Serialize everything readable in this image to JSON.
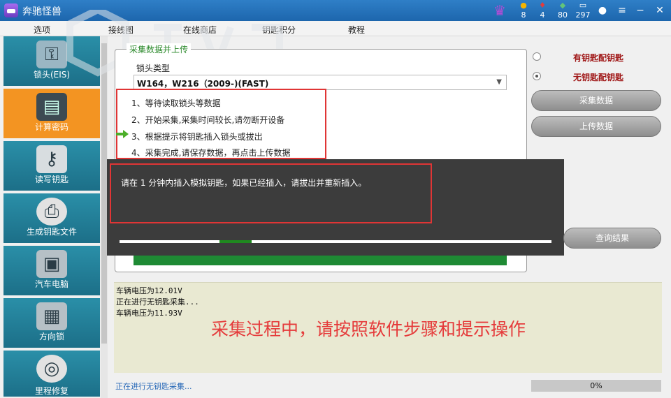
{
  "window": {
    "title": "奔驰怪兽",
    "stats": [
      {
        "icon": "coin-icon",
        "value": "8",
        "color": "#f5b400"
      },
      {
        "icon": "ruby-icon",
        "value": "4",
        "color": "#e53b3b"
      },
      {
        "icon": "diamond-icon",
        "value": "80",
        "color": "#63c47a"
      },
      {
        "icon": "battery-icon",
        "value": "297",
        "color": "#ffffff"
      }
    ]
  },
  "menu": [
    "选项",
    "接线图",
    "在线商店",
    "钥匙积分",
    "教程"
  ],
  "sidebar": {
    "items": [
      {
        "label": "锁头(EIS)",
        "icon": "lock-module-icon",
        "active": false
      },
      {
        "label": "计算密码",
        "icon": "computer-screen-icon",
        "active": true
      },
      {
        "label": "读写钥匙",
        "icon": "car-key-icon",
        "active": false
      },
      {
        "label": "生成钥匙文件",
        "icon": "printer-icon",
        "active": false
      },
      {
        "label": "汽车电脑",
        "icon": "ecu-icon",
        "active": false
      },
      {
        "label": "方向锁",
        "icon": "steering-lock-icon",
        "active": false
      },
      {
        "label": "里程修复",
        "icon": "speedometer-icon",
        "active": false
      }
    ]
  },
  "main": {
    "group_title": "采集数据并上传",
    "lock_type_label": "锁头类型",
    "lock_type_value": "W164，W216（2009-)(FAST)",
    "steps": [
      "1、等待读取锁头等数据",
      "2、开始采集,采集时间较长,请勿断开设备",
      "3、根据提示将钥匙插入锁头或拔出",
      "4、采集完成,请保存数据，再点击上传数据"
    ],
    "current_step": 3,
    "dialog_message": "请在  1  分钟内插入模拟钥匙，如果已经插入，请拔出并重新插入。"
  },
  "right": {
    "radio_options": [
      {
        "label": "有钥匙配钥匙",
        "selected": false
      },
      {
        "label": "无钥匙配钥匙",
        "selected": true
      }
    ],
    "collect_button": "采集数据",
    "upload_button": "上传数据",
    "query_button": "查询结果"
  },
  "log": {
    "lines": [
      "车辆电压为12.01V",
      "正在进行无钥匙采集...",
      "车辆电压为11.93V"
    ],
    "overlay_note": "采集过程中，请按照软件步骤和提示操作"
  },
  "status": {
    "text": "正在进行无钥匙采集...",
    "progress": "0%"
  },
  "colors": {
    "accent_orange": "#f39422",
    "teal": "#1f7a95",
    "alert_red": "#e03535",
    "progress_green": "#1e8a34"
  }
}
